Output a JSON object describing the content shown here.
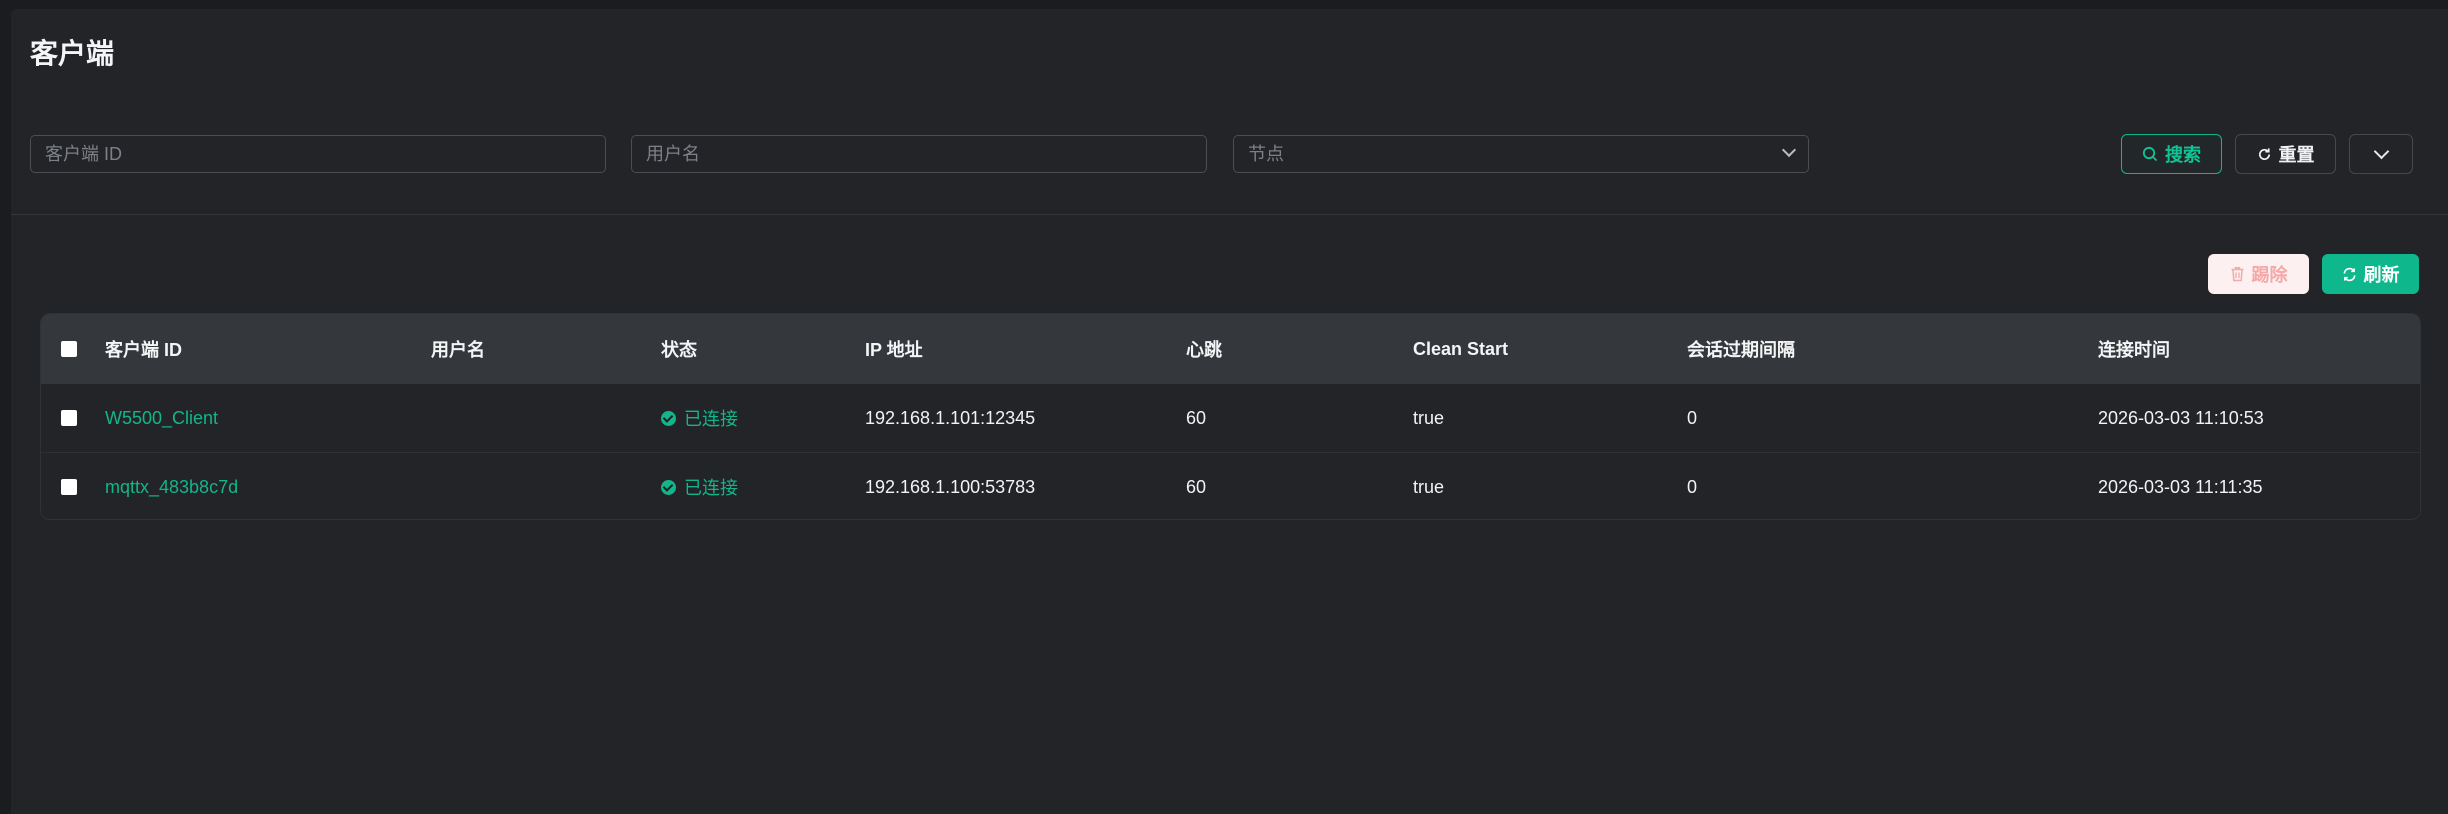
{
  "page": {
    "title": "客户端"
  },
  "filters": {
    "client_id_placeholder": "客户端 ID",
    "username_placeholder": "用户名",
    "node_placeholder": "节点",
    "search_label": "搜索",
    "reset_label": "重置"
  },
  "actions": {
    "delete_label": "踢除",
    "refresh_label": "刷新"
  },
  "table": {
    "headers": [
      "客户端 ID",
      "用户名",
      "状态",
      "IP 地址",
      "心跳",
      "Clean Start",
      "会话过期间隔",
      "连接时间"
    ],
    "rows": [
      {
        "client_id": "W5500_Client",
        "username": "",
        "status": "已连接",
        "ip": "192.168.1.101:12345",
        "keepalive": "60",
        "clean_start": "true",
        "expiry": "0",
        "connected_at": "2026-03-03 11:10:53"
      },
      {
        "client_id": "mqttx_483b8c7d",
        "username": "",
        "status": "已连接",
        "ip": "192.168.1.100:53783",
        "keepalive": "60",
        "clean_start": "true",
        "expiry": "0",
        "connected_at": "2026-03-03 11:11:35"
      }
    ]
  },
  "colors": {
    "accent": "#0fb88c",
    "danger_bg": "#fdf0f0",
    "danger_text": "#f4a8a8"
  },
  "icons": [
    "search-icon",
    "reset-icon",
    "chevron-down-icon",
    "trash-icon",
    "refresh-icon",
    "check-circle-icon"
  ]
}
